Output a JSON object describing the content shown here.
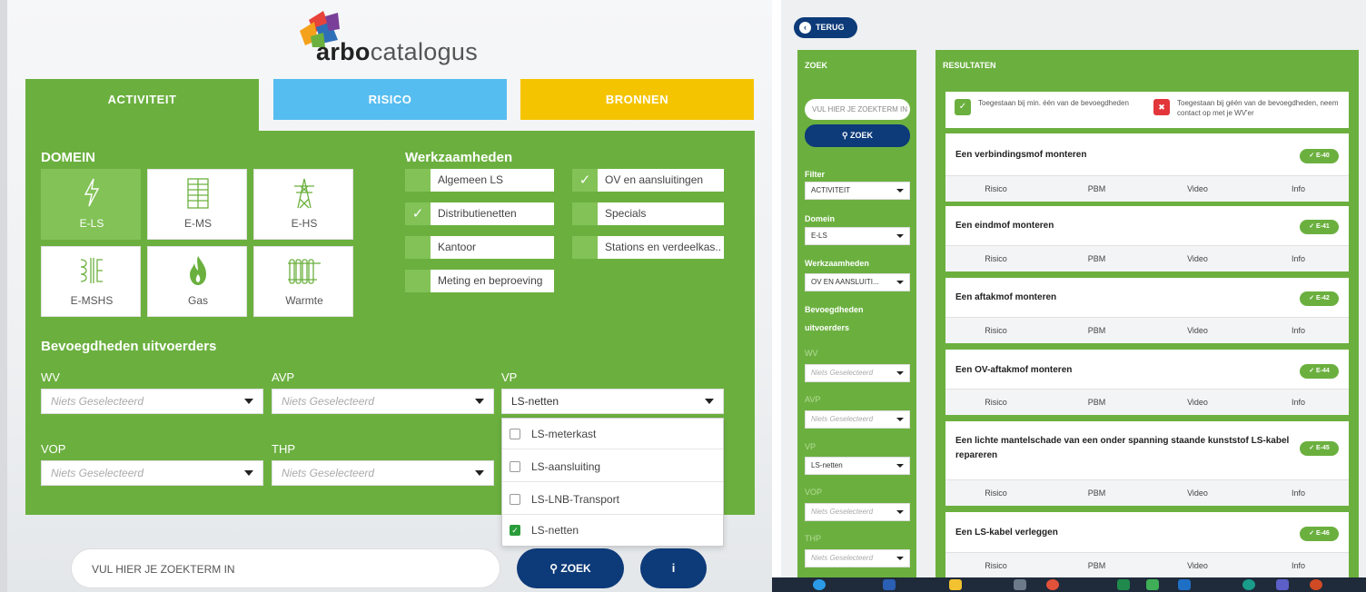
{
  "left": {
    "logo": {
      "bold": "arbo",
      "rest": "catalogus"
    },
    "tabs": {
      "activiteit": "ACTIVITEIT",
      "risico": "RISICO",
      "bronnen": "BRONNEN"
    },
    "domein_title": "DOMEIN",
    "domein": [
      "E-LS",
      "E-MS",
      "E-HS",
      "E-MSHS",
      "Gas",
      "Warmte"
    ],
    "werkzaamheden_title": "Werkzaamheden",
    "werkzaamheden": [
      {
        "label": "Algemeen LS",
        "checked": false
      },
      {
        "label": "OV en aansluitingen",
        "checked": true
      },
      {
        "label": "Distributienetten",
        "checked": true
      },
      {
        "label": "Specials",
        "checked": false
      },
      {
        "label": "Kantoor",
        "checked": false
      },
      {
        "label": "Stations en verdeelkas...",
        "checked": false
      },
      {
        "label": "Meting en beproeving",
        "checked": false
      }
    ],
    "bevoegdheden_title": "Bevoegdheden uitvoerders",
    "filters": {
      "wv": {
        "label": "WV",
        "value": "Niets Geselecteerd"
      },
      "avp": {
        "label": "AVP",
        "value": "Niets Geselecteerd"
      },
      "vp": {
        "label": "VP",
        "value": "LS-netten"
      },
      "vop": {
        "label": "VOP",
        "value": "Niets Geselecteerd"
      },
      "thp": {
        "label": "THP",
        "value": "Niets Geselecteerd"
      }
    },
    "dropdown": [
      {
        "label": "LS-meterkast",
        "checked": false
      },
      {
        "label": "LS-aansluiting",
        "checked": false
      },
      {
        "label": "LS-LNB-Transport",
        "checked": false
      },
      {
        "label": "LS-netten",
        "checked": true
      }
    ],
    "search_placeholder": "VUL HIER JE ZOEKTERM IN",
    "zoek_label": "ZOEK",
    "info_label": "i"
  },
  "right": {
    "terug": "TERUG",
    "zoek_header": "ZOEK",
    "search_placeholder": "VUL HIER JE ZOEKTERM IN",
    "zoek_btn": "ZOEK",
    "filter_label": "Filter",
    "filter_value": "ACTIVITEIT",
    "domein_label": "Domein",
    "domein_value": "E-LS",
    "werkzaamheden_label": "Werkzaamheden",
    "werkzaamheden_value": "OV EN AANSLUITI...",
    "bevoegdheden_label1": "Bevoegdheden",
    "bevoegdheden_label2": "uitvoerders",
    "wv_label": "WV",
    "wv_value": "Niets Geselecteerd",
    "avp_label": "AVP",
    "avp_value": "Niets Geselecteerd",
    "vp_label": "VP",
    "vp_value": "LS-netten",
    "vop_label": "VOP",
    "vop_value": "Niets Geselecteerd",
    "thp_label": "THP",
    "thp_value": "Niets Geselecteerd",
    "resultaten_header": "RESULTATEN",
    "legend_green": "Toegestaan bij min. één van de bevoegdheden",
    "legend_red": "Toegestaan bij géén van de bevoegdheden, neem contact op met je WV'er",
    "row_labels": [
      "Risico",
      "PBM",
      "Video",
      "Info"
    ],
    "results": [
      {
        "title": "Een verbindingsmof monteren",
        "code": "E-40"
      },
      {
        "title": "Een eindmof monteren",
        "code": "E-41"
      },
      {
        "title": "Een aftakmof monteren",
        "code": "E-42"
      },
      {
        "title": "Een OV-aftakmof monteren",
        "code": "E-44"
      },
      {
        "title": "Een lichte mantelschade van een onder spanning staande kunststof LS-kabel repareren",
        "code": "E-45"
      },
      {
        "title": "Een LS-kabel verleggen",
        "code": "E-46"
      }
    ]
  },
  "colors": {
    "green": "#6bb03f",
    "blue": "#56bdf0",
    "yellow": "#f5c400",
    "navy": "#0d3a78",
    "red": "#e3363b"
  }
}
